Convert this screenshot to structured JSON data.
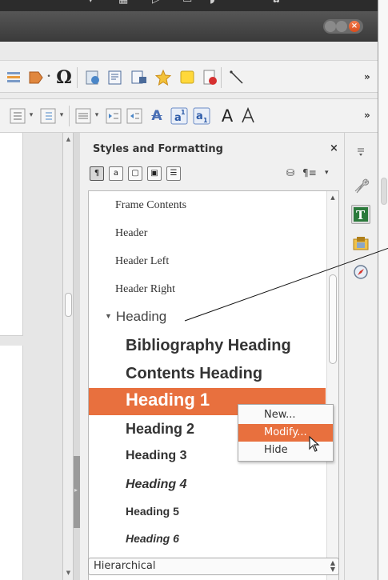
{
  "sidebar": {
    "title": "Styles and Formatting",
    "close_label": "×",
    "family_buttons": [
      "¶",
      "a",
      "▢",
      "▣",
      "☰"
    ],
    "items": {
      "frame_contents": "Frame Contents",
      "header": "Header",
      "header_left": "Header Left",
      "header_right": "Header Right",
      "heading": "Heading",
      "bibliography_heading": "Bibliography Heading",
      "contents_heading": "Contents Heading",
      "heading_1": "Heading 1",
      "heading_2": "Heading 2",
      "heading_3": "Heading 3",
      "heading_4": "Heading 4",
      "heading_5": "Heading 5",
      "heading_6": "Heading 6"
    },
    "filter_value": "Hierarchical"
  },
  "context_menu": {
    "new_label": "New...",
    "modify_label": "Modify...",
    "hide_label": "Hide"
  },
  "toolbar": {
    "more_label": "»"
  },
  "colors": {
    "accent": "#e8703e",
    "titlebar": "#3b3b3b"
  }
}
